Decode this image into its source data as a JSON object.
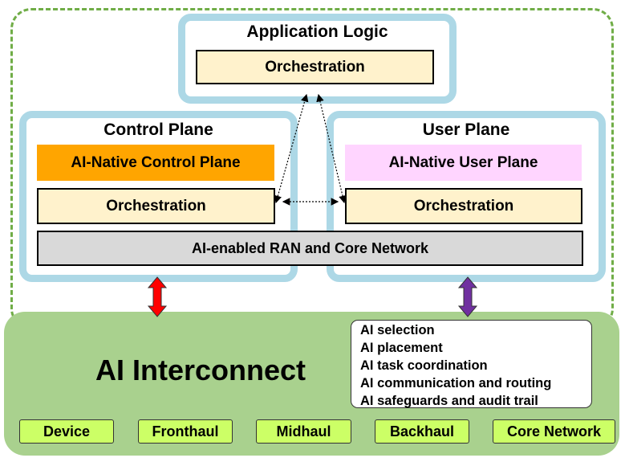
{
  "application_logic": {
    "title": "Application Logic",
    "orchestration": "Orchestration"
  },
  "control_plane": {
    "title": "Control Plane",
    "ai_native": "AI-Native Control Plane",
    "orchestration": "Orchestration"
  },
  "user_plane": {
    "title": "User Plane",
    "ai_native": "AI-Native User Plane",
    "orchestration": "Orchestration"
  },
  "ran_core": "AI-enabled RAN and Core Network",
  "interconnect": {
    "title": "AI Interconnect",
    "functions": [
      "AI selection",
      "AI placement",
      "AI task coordination",
      "AI communication and routing",
      "AI safeguards and audit trail"
    ],
    "segments": [
      "Device",
      "Fronthaul",
      "Midhaul",
      "Backhaul",
      "Core Network"
    ]
  },
  "colors": {
    "panel_border": "#add8e6",
    "ai_native_control": "#ffa500",
    "ai_native_user": "#ffd5ff",
    "orchestration": "#fff2cc",
    "ran": "#d9d9d9",
    "interconnect": "#a9d18e",
    "segment": "#ccff66",
    "control_arrow": "#ff0000",
    "user_arrow": "#7030a0"
  }
}
